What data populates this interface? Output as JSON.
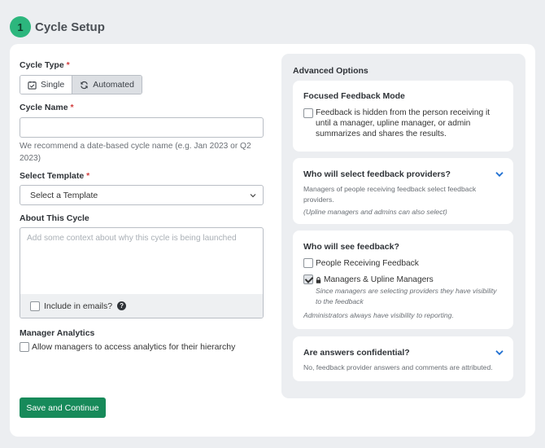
{
  "step": {
    "number": "1",
    "title": "Cycle Setup"
  },
  "cycle_type": {
    "label": "Cycle Type",
    "required": "*",
    "options": [
      {
        "label": "Single",
        "icon": "calendar-check-icon",
        "active": false
      },
      {
        "label": "Automated",
        "icon": "refresh-icon",
        "active": true
      }
    ]
  },
  "cycle_name": {
    "label": "Cycle Name",
    "required": "*",
    "value": "",
    "placeholder": "",
    "hint": "We recommend a date-based cycle name (e.g. Jan 2023 or Q2 2023)"
  },
  "template": {
    "label": "Select Template",
    "required": "*",
    "selected": "Select a Template"
  },
  "about": {
    "label": "About This Cycle",
    "placeholder": "Add some context about why this cycle is being launched",
    "include_label": "Include in emails?"
  },
  "manager_analytics": {
    "label": "Manager Analytics",
    "checkbox_label": "Allow managers to access analytics for their hierarchy"
  },
  "save_button": "Save and Continue",
  "advanced": {
    "title": "Advanced Options",
    "focused": {
      "title": "Focused Feedback Mode",
      "line1": "Feedback is hidden from the person receiving it",
      "line2": "until a manager, upline manager, or admin",
      "line3": "summarizes and shares the results."
    },
    "providers": {
      "title": "Who will select feedback providers?",
      "line1": "Managers of people receiving feedback select feedback",
      "line2": "providers.",
      "note": "(Upline managers and admins can also select)"
    },
    "see": {
      "title": "Who will see feedback?",
      "opt1": "People Receiving Feedback",
      "opt2": "Managers & Upline Managers",
      "opt2_sub1": "Since managers are selecting providers they have visibility",
      "opt2_sub2": "to the feedback",
      "footer": "Administrators always have visibility to reporting."
    },
    "confidential": {
      "title": "Are answers confidential?",
      "desc": "No, feedback provider answers and comments are attributed."
    }
  },
  "colors": {
    "accent": "#178a5a",
    "step": "#2cb67d",
    "link": "#1f6fd1"
  }
}
